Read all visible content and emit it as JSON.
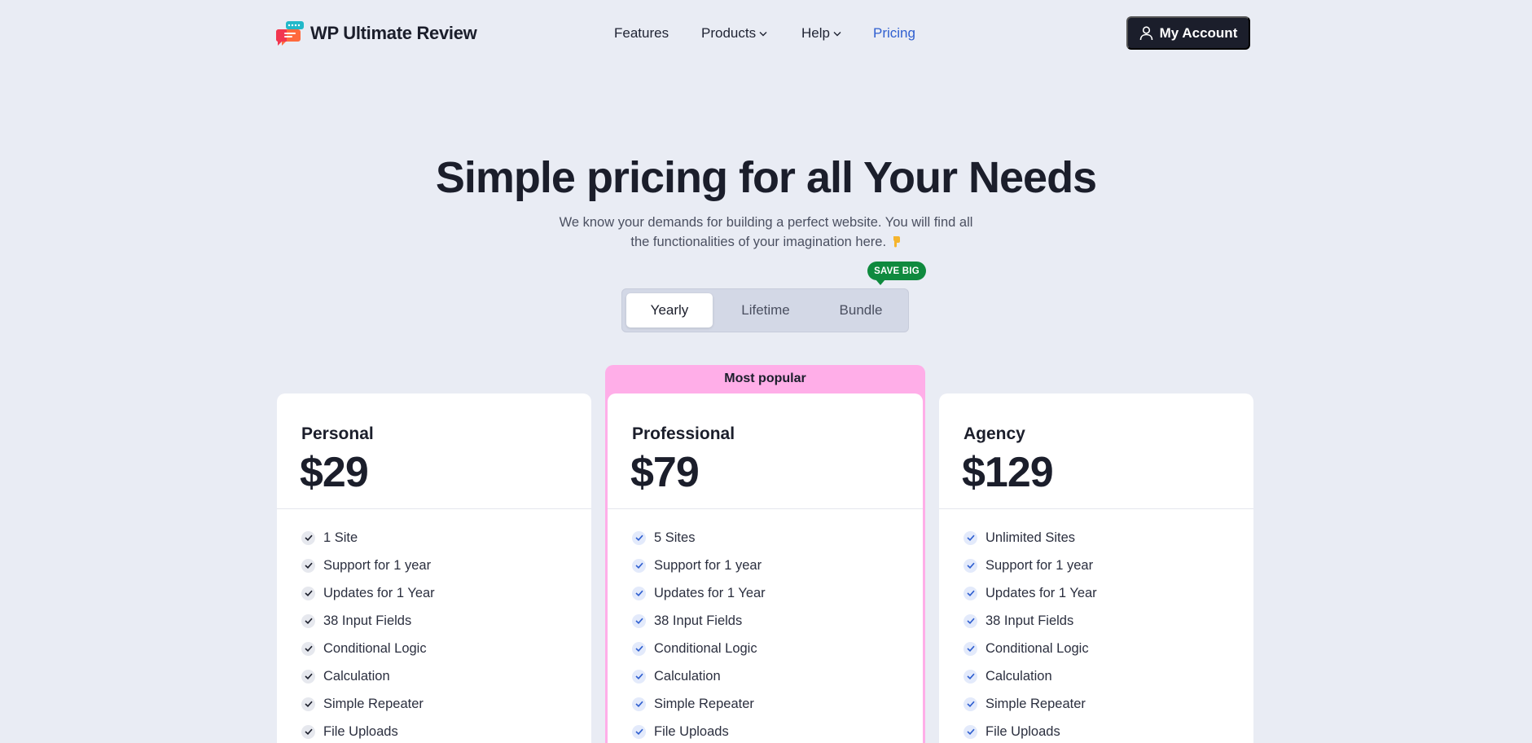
{
  "header": {
    "brand": "WP Ultimate Review",
    "nav": [
      {
        "label": "Features",
        "has_dropdown": false,
        "active": false
      },
      {
        "label": "Products",
        "has_dropdown": true,
        "active": false
      },
      {
        "label": "Help",
        "has_dropdown": true,
        "active": false
      },
      {
        "label": "Pricing",
        "has_dropdown": false,
        "active": true
      }
    ],
    "account_label": "My Account",
    "account_icon": "user-icon"
  },
  "hero": {
    "title": "Simple pricing for all Your Needs",
    "subtitle_line1": "We know your demands for building a perfect website. You will find all",
    "subtitle_line2": "the functionalities of your imagination here.",
    "subtitle_icon": "pointing-down-hand-icon"
  },
  "billing_toggle": {
    "options": [
      "Yearly",
      "Lifetime",
      "Bundle"
    ],
    "selected": "Yearly",
    "badge": "SAVE BIG"
  },
  "pricing": {
    "popular_label": "Most popular",
    "plans": [
      {
        "name": "Personal",
        "price": "$29",
        "features": [
          "1 Site",
          "Support for 1 year",
          "Updates for 1 Year",
          "38 Input Fields",
          "Conditional Logic",
          "Calculation",
          "Simple Repeater",
          "File Uploads"
        ]
      },
      {
        "name": "Professional",
        "price": "$79",
        "features": [
          "5 Sites",
          "Support for 1 year",
          "Updates for 1 Year",
          "38 Input Fields",
          "Conditional Logic",
          "Calculation",
          "Simple Repeater",
          "File Uploads"
        ]
      },
      {
        "name": "Agency",
        "price": "$129",
        "features": [
          "Unlimited Sites",
          "Support for 1 year",
          "Updates for 1 Year",
          "38 Input Fields",
          "Conditional Logic",
          "Calculation",
          "Simple Repeater",
          "File Uploads"
        ]
      }
    ]
  },
  "colors": {
    "background": "#e9ecf4",
    "accent_link": "#2f5fd0",
    "dark": "#1b1e2b",
    "popular_frame": "#ffaee8",
    "badge_green": "#0f8a3e"
  }
}
